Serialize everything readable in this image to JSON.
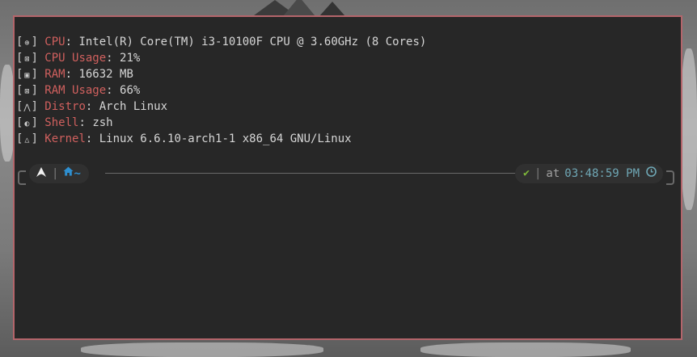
{
  "system_info": [
    {
      "icon": "cpu-icon",
      "glyph": "⊕",
      "key": "CPU",
      "value": "Intel(R) Core(TM) i3-10100F CPU @ 3.60GHz (8 Cores)"
    },
    {
      "icon": "cpu-usage-icon",
      "glyph": "⊠",
      "key": "CPU Usage",
      "value": "21%"
    },
    {
      "icon": "ram-icon",
      "glyph": "▣",
      "key": "RAM",
      "value": "16632 MB"
    },
    {
      "icon": "ram-usage-icon",
      "glyph": "⊠",
      "key": "RAM Usage",
      "value": "66%"
    },
    {
      "icon": "distro-icon",
      "glyph": "⋀",
      "key": "Distro",
      "value": "Arch Linux"
    },
    {
      "icon": "shell-icon",
      "glyph": "◐",
      "key": "Shell",
      "value": "zsh"
    },
    {
      "icon": "kernel-icon",
      "glyph": "△",
      "key": "Kernel",
      "value": "Linux 6.6.10-arch1-1 x86_64 GNU/Linux"
    }
  ],
  "prompt": {
    "os_icon": "arch-linux-icon",
    "dir_icon": "home-icon",
    "directory": "~",
    "status_icon": "checkmark-icon",
    "at_label": "at",
    "time": "03:48:59 PM",
    "time_icon": "clock-icon"
  },
  "colors": {
    "border": "#b4656b",
    "key": "#d0605e",
    "dir": "#2e8fd0",
    "time": "#6fa7b5",
    "check": "#7fb83a"
  }
}
